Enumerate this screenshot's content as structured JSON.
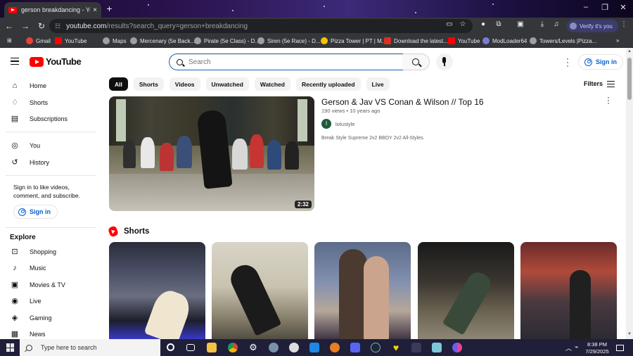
{
  "browser": {
    "tab_title": "gerson breakdancing - YouTube",
    "tab_close": "×",
    "new_tab": "+",
    "window_controls": [
      "–",
      "❐",
      "✕"
    ],
    "url_host": "youtube.com",
    "url_rest": "/results?search_query=gerson+breakdancing",
    "verify_label": "Verify it's you",
    "bookmarks": [
      {
        "label": "Gmail",
        "color": "#ea4335"
      },
      {
        "label": "YouTube",
        "color": "#ff0000"
      },
      {
        "label": "Maps",
        "color": "#34a853"
      },
      {
        "label": "Mercenary (5e Back...",
        "color": "#9aa0a6"
      },
      {
        "label": "Pirate (5e Class) - D...",
        "color": "#9aa0a6"
      },
      {
        "label": "Siren (5e Race) - D...",
        "color": "#9aa0a6"
      },
      {
        "label": "Pizza Tower | PT | M...",
        "color": "#f2c300"
      },
      {
        "label": "Download the latest...",
        "color": "#d93025"
      },
      {
        "label": "YouTube",
        "color": "#ff0000"
      },
      {
        "label": "ModLoader64",
        "color": "#7b7bd6"
      },
      {
        "label": "Towers/Levels |Pizza...",
        "color": "#9aa0a6"
      }
    ]
  },
  "masthead": {
    "logo_text": "YouTube",
    "search_placeholder": "Search",
    "search_value": "",
    "signin_label": "Sign in"
  },
  "sidebar": {
    "items": [
      {
        "label": "Home",
        "icon": "⌂"
      },
      {
        "label": "Shorts",
        "icon": "♢"
      },
      {
        "label": "Subscriptions",
        "icon": "▤"
      },
      {
        "label": "You",
        "icon": "◎"
      },
      {
        "label": "History",
        "icon": "↺"
      }
    ],
    "signin_note": "Sign in to like videos, comment, and subscribe.",
    "signin_label": "Sign in",
    "explore_title": "Explore",
    "explore_items": [
      {
        "label": "Shopping",
        "icon": "⊡"
      },
      {
        "label": "Music",
        "icon": "♪"
      },
      {
        "label": "Movies & TV",
        "icon": "▣"
      },
      {
        "label": "Live",
        "icon": "◉"
      },
      {
        "label": "Gaming",
        "icon": "◈"
      },
      {
        "label": "News",
        "icon": "▦"
      }
    ]
  },
  "filters": {
    "chips": [
      "All",
      "Shorts",
      "Videos",
      "Unwatched",
      "Watched",
      "Recently uploaded",
      "Live"
    ],
    "active": "All",
    "filters_label": "Filters"
  },
  "result": {
    "title": "Gerson & Jav VS Conan & Wilson // Top 16",
    "meta": "190 views • 10 years ago",
    "channel_initial": "l",
    "channel_name": "lotustyle",
    "description": "Break Style Supreme 2v2 BBOY 2v2 All-Styles.",
    "duration": "2:32"
  },
  "shorts": {
    "title": "Shorts",
    "count": 5
  },
  "taskbar": {
    "search_placeholder": "Type here to search",
    "time": "8:38 PM",
    "date": "7/29/2025"
  }
}
